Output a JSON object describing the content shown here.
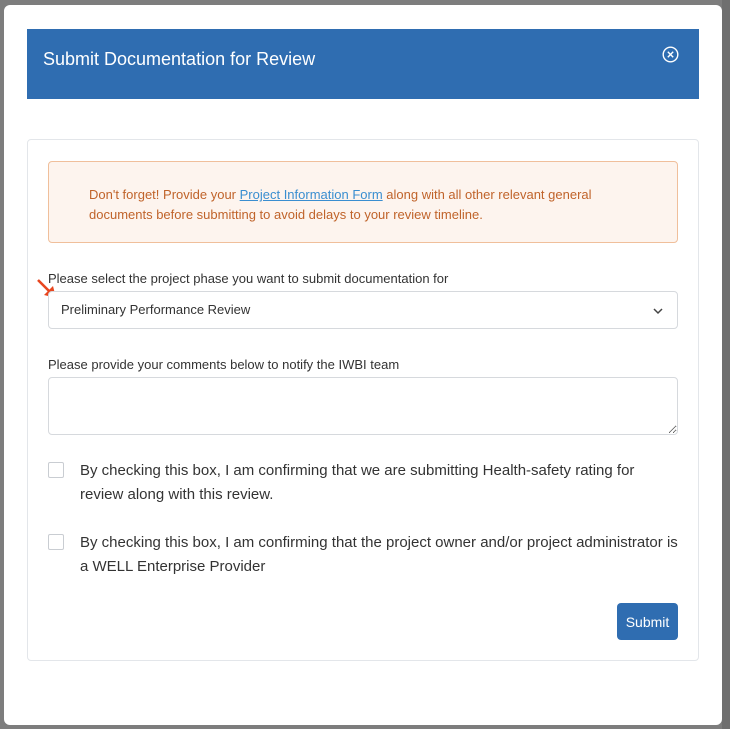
{
  "modal": {
    "title": "Submit Documentation for Review",
    "close_icon": "close-circle-icon"
  },
  "alert": {
    "text_before": "Don't forget! Provide your ",
    "link_text": "Project Information Form",
    "text_after": " along with all other relevant general documents before submitting to avoid delays to your review timeline.",
    "text_color": "#c0632a",
    "background": "#fdf4ee"
  },
  "phase": {
    "label": "Please select the project phase you want to submit documentation for",
    "selected": "Preliminary Performance Review",
    "chevron_icon": "chevron-down-icon"
  },
  "comments": {
    "label": "Please provide your comments below to notify the IWBI team",
    "value": ""
  },
  "checkboxes": [
    {
      "label": "By checking this box, I am confirming that we are submitting Health-safety rating for review along with this review.",
      "checked": false
    },
    {
      "label": "By checking this box, I am confirming that the project owner and/or project administrator is a WELL Enterprise Provider",
      "checked": false
    }
  ],
  "submit_label": "Submit",
  "colors": {
    "primary": "#2f6db1",
    "annotation_arrow": "#e8461f"
  }
}
